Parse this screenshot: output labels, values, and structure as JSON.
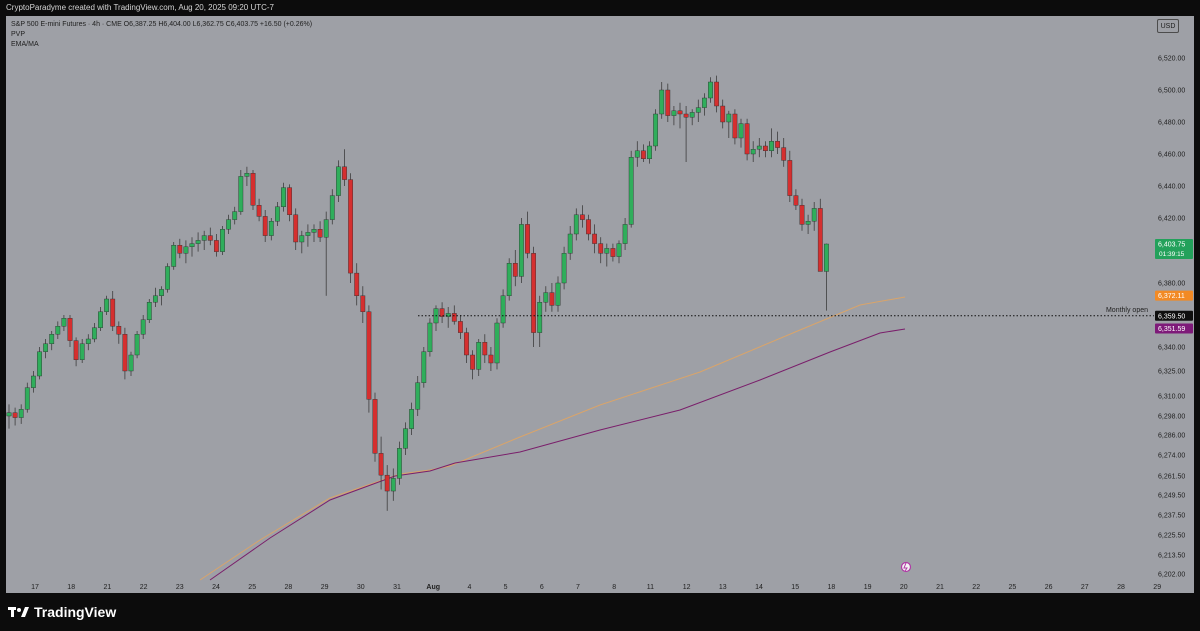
{
  "header": {
    "credit": "CryptoParadyme created with TradingView.com, Aug 20, 2025 09:20 UTC-7"
  },
  "legend": {
    "symbol_line": "S&P 500 E-mini Futures · 4h · CME  O6,387.25  H6,404.00  L6,362.75  C6,403.75  +16.50 (+0.26%)",
    "indicator_1": "PVP",
    "indicator_2": "EMA/MA"
  },
  "currency": "USD",
  "brand": {
    "name": "TradingView"
  },
  "chart_data": {
    "type": "candlestick",
    "timeframe": "4h",
    "x_tick_labels": [
      "17",
      "18",
      "21",
      "22",
      "23",
      "24",
      "25",
      "28",
      "29",
      "30",
      "31",
      "Aug",
      "4",
      "5",
      "6",
      "7",
      "8",
      "11",
      "12",
      "13",
      "14",
      "15",
      "18",
      "19",
      "20",
      "21",
      "22",
      "25",
      "26",
      "27",
      "28",
      "29"
    ],
    "y_tick_labels": [
      "6,520.00",
      "6,500.00",
      "6,480.00",
      "6,460.00",
      "6,440.00",
      "6,420.00",
      "6,400.00",
      "6,380.00",
      "6,360.00",
      "6,340.00",
      "6,325.00",
      "6,310.00",
      "6,298.00",
      "6,286.00",
      "6,274.00",
      "6,261.50",
      "6,249.50",
      "6,237.50",
      "6,225.50",
      "6,213.50",
      "6,202.00"
    ],
    "ylim": [
      6202.0,
      6530.0
    ],
    "price_scale": [
      [
        6202.0,
        574
      ],
      [
        6213.5,
        555
      ],
      [
        6225.5,
        535
      ],
      [
        6237.5,
        515
      ],
      [
        6249.5,
        495
      ],
      [
        6261.5,
        476
      ],
      [
        6274.0,
        455
      ],
      [
        6286.0,
        435
      ],
      [
        6298.0,
        416
      ],
      [
        6310.0,
        396
      ],
      [
        6325.0,
        371
      ],
      [
        6340.0,
        347
      ],
      [
        6360.0,
        315
      ],
      [
        6380.0,
        283
      ],
      [
        6400.0,
        250
      ],
      [
        6420.0,
        218
      ],
      [
        6440.0,
        186
      ],
      [
        6460.0,
        154
      ],
      [
        6480.0,
        122
      ],
      [
        6500.0,
        90
      ],
      [
        6520.0,
        58
      ]
    ],
    "candle_start_x": 9,
    "candle_step": 6.1,
    "candle_pattern": "Sequential 4h bars from Jul 17 to Aug 20, 2025; OHLC estimated from the screenshot",
    "ohlc": [
      [
        6298,
        6305,
        6290,
        6300
      ],
      [
        6300,
        6303,
        6292,
        6297
      ],
      [
        6297,
        6305,
        6293,
        6302
      ],
      [
        6302,
        6318,
        6300,
        6315
      ],
      [
        6315,
        6325,
        6312,
        6322
      ],
      [
        6322,
        6340,
        6320,
        6337
      ],
      [
        6337,
        6345,
        6333,
        6342
      ],
      [
        6342,
        6350,
        6338,
        6348
      ],
      [
        6348,
        6356,
        6345,
        6353
      ],
      [
        6353,
        6360,
        6350,
        6358
      ],
      [
        6358,
        6360,
        6340,
        6344
      ],
      [
        6344,
        6346,
        6328,
        6332
      ],
      [
        6332,
        6345,
        6330,
        6342
      ],
      [
        6342,
        6348,
        6338,
        6345
      ],
      [
        6345,
        6355,
        6343,
        6352
      ],
      [
        6352,
        6365,
        6350,
        6362
      ],
      [
        6362,
        6372,
        6360,
        6370
      ],
      [
        6370,
        6375,
        6350,
        6353
      ],
      [
        6353,
        6356,
        6342,
        6348
      ],
      [
        6348,
        6352,
        6320,
        6325
      ],
      [
        6325,
        6337,
        6322,
        6335
      ],
      [
        6335,
        6350,
        6333,
        6348
      ],
      [
        6348,
        6360,
        6345,
        6357
      ],
      [
        6357,
        6370,
        6355,
        6368
      ],
      [
        6368,
        6377,
        6365,
        6372
      ],
      [
        6372,
        6378,
        6366,
        6376
      ],
      [
        6376,
        6392,
        6374,
        6390
      ],
      [
        6390,
        6405,
        6388,
        6403
      ],
      [
        6403,
        6407,
        6395,
        6398
      ],
      [
        6398,
        6406,
        6392,
        6402
      ],
      [
        6402,
        6408,
        6396,
        6404
      ],
      [
        6404,
        6411,
        6399,
        6406
      ],
      [
        6406,
        6412,
        6400,
        6409
      ],
      [
        6409,
        6414,
        6403,
        6406
      ],
      [
        6406,
        6410,
        6396,
        6399
      ],
      [
        6399,
        6415,
        6397,
        6413
      ],
      [
        6413,
        6422,
        6410,
        6419
      ],
      [
        6419,
        6427,
        6416,
        6424
      ],
      [
        6424,
        6450,
        6422,
        6446
      ],
      [
        6446,
        6452,
        6440,
        6448
      ],
      [
        6448,
        6450,
        6425,
        6428
      ],
      [
        6428,
        6432,
        6418,
        6421
      ],
      [
        6421,
        6425,
        6405,
        6409
      ],
      [
        6409,
        6420,
        6406,
        6418
      ],
      [
        6418,
        6430,
        6415,
        6427
      ],
      [
        6427,
        6442,
        6424,
        6439
      ],
      [
        6439,
        6441,
        6418,
        6422
      ],
      [
        6422,
        6426,
        6400,
        6405
      ],
      [
        6405,
        6412,
        6398,
        6409
      ],
      [
        6409,
        6416,
        6402,
        6411
      ],
      [
        6411,
        6416,
        6405,
        6413
      ],
      [
        6413,
        6418,
        6405,
        6408
      ],
      [
        6408,
        6424,
        6372,
        6419
      ],
      [
        6419,
        6438,
        6416,
        6434
      ],
      [
        6434,
        6456,
        6430,
        6452
      ],
      [
        6452,
        6463,
        6440,
        6444
      ],
      [
        6444,
        6448,
        6380,
        6386
      ],
      [
        6386,
        6392,
        6366,
        6372
      ],
      [
        6372,
        6378,
        6355,
        6362
      ],
      [
        6362,
        6366,
        6300,
        6308
      ],
      [
        6308,
        6312,
        6270,
        6275
      ],
      [
        6275,
        6285,
        6253,
        6262
      ],
      [
        6262,
        6268,
        6240,
        6252
      ],
      [
        6252,
        6266,
        6246,
        6260
      ],
      [
        6260,
        6282,
        6256,
        6278
      ],
      [
        6278,
        6294,
        6274,
        6290
      ],
      [
        6290,
        6306,
        6286,
        6302
      ],
      [
        6302,
        6322,
        6298,
        6318
      ],
      [
        6318,
        6340,
        6315,
        6337
      ],
      [
        6337,
        6358,
        6334,
        6355
      ],
      [
        6355,
        6366,
        6350,
        6364
      ],
      [
        6364,
        6368,
        6355,
        6359
      ],
      [
        6359,
        6365,
        6352,
        6361
      ],
      [
        6361,
        6366,
        6354,
        6356
      ],
      [
        6356,
        6360,
        6345,
        6349
      ],
      [
        6349,
        6352,
        6330,
        6335
      ],
      [
        6335,
        6338,
        6320,
        6326
      ],
      [
        6326,
        6345,
        6322,
        6343
      ],
      [
        6343,
        6348,
        6330,
        6335
      ],
      [
        6335,
        6340,
        6325,
        6330
      ],
      [
        6330,
        6358,
        6326,
        6355
      ],
      [
        6355,
        6376,
        6352,
        6372
      ],
      [
        6372,
        6395,
        6369,
        6392
      ],
      [
        6392,
        6400,
        6378,
        6384
      ],
      [
        6384,
        6420,
        6380,
        6416
      ],
      [
        6416,
        6424,
        6395,
        6398
      ],
      [
        6398,
        6402,
        6340,
        6349
      ],
      [
        6349,
        6372,
        6340,
        6368
      ],
      [
        6368,
        6378,
        6362,
        6374
      ],
      [
        6374,
        6380,
        6362,
        6366
      ],
      [
        6366,
        6384,
        6362,
        6380
      ],
      [
        6380,
        6402,
        6376,
        6398
      ],
      [
        6398,
        6415,
        6394,
        6410
      ],
      [
        6410,
        6426,
        6406,
        6422
      ],
      [
        6422,
        6428,
        6414,
        6419
      ],
      [
        6419,
        6422,
        6406,
        6410
      ],
      [
        6410,
        6416,
        6398,
        6404
      ],
      [
        6404,
        6408,
        6392,
        6398
      ],
      [
        6398,
        6404,
        6390,
        6401
      ],
      [
        6401,
        6404,
        6393,
        6396
      ],
      [
        6396,
        6406,
        6392,
        6404
      ],
      [
        6404,
        6420,
        6400,
        6416
      ],
      [
        6416,
        6462,
        6414,
        6458
      ],
      [
        6458,
        6468,
        6452,
        6462
      ],
      [
        6462,
        6466,
        6455,
        6457
      ],
      [
        6457,
        6468,
        6454,
        6465
      ],
      [
        6465,
        6488,
        6462,
        6485
      ],
      [
        6485,
        6505,
        6482,
        6500
      ],
      [
        6500,
        6504,
        6480,
        6484
      ],
      [
        6484,
        6490,
        6478,
        6487
      ],
      [
        6487,
        6492,
        6476,
        6485
      ],
      [
        6485,
        6490,
        6455,
        6483
      ],
      [
        6483,
        6488,
        6478,
        6486
      ],
      [
        6486,
        6494,
        6480,
        6489
      ],
      [
        6489,
        6498,
        6484,
        6495
      ],
      [
        6495,
        6508,
        6492,
        6505
      ],
      [
        6505,
        6509,
        6486,
        6490
      ],
      [
        6490,
        6494,
        6476,
        6480
      ],
      [
        6480,
        6487,
        6470,
        6485
      ],
      [
        6485,
        6488,
        6466,
        6470
      ],
      [
        6470,
        6482,
        6464,
        6479
      ],
      [
        6479,
        6482,
        6456,
        6460
      ],
      [
        6460,
        6468,
        6455,
        6463
      ],
      [
        6463,
        6470,
        6458,
        6465
      ],
      [
        6465,
        6468,
        6458,
        6462
      ],
      [
        6462,
        6476,
        6458,
        6468
      ],
      [
        6468,
        6474,
        6460,
        6464
      ],
      [
        6464,
        6470,
        6452,
        6456
      ],
      [
        6456,
        6462,
        6430,
        6434
      ],
      [
        6434,
        6438,
        6425,
        6428
      ],
      [
        6428,
        6432,
        6412,
        6416
      ],
      [
        6416,
        6422,
        6410,
        6418
      ],
      [
        6418,
        6430,
        6412,
        6426
      ],
      [
        6426,
        6432,
        6400,
        6387
      ],
      [
        6387,
        6404,
        6362.75,
        6403.75
      ]
    ],
    "overlays": [
      {
        "name": "EMA",
        "color": "#d9a46a",
        "points": [
          [
            200,
            580
          ],
          [
            260,
            540
          ],
          [
            330,
            498
          ],
          [
            400,
            474
          ],
          [
            430,
            470
          ],
          [
            450,
            466
          ],
          [
            520,
            437
          ],
          [
            600,
            405
          ],
          [
            700,
            372
          ],
          [
            800,
            330
          ],
          [
            860,
            305
          ],
          [
            905,
            297
          ]
        ]
      },
      {
        "name": "MA",
        "color": "#7a1f6b",
        "points": [
          [
            210,
            580
          ],
          [
            270,
            538
          ],
          [
            330,
            500
          ],
          [
            395,
            476
          ],
          [
            430,
            471
          ],
          [
            455,
            463
          ],
          [
            520,
            452
          ],
          [
            600,
            430
          ],
          [
            680,
            410
          ],
          [
            760,
            380
          ],
          [
            830,
            352
          ],
          [
            880,
            333
          ],
          [
            905,
            329
          ]
        ]
      }
    ],
    "horizontal_line": {
      "label": "Monthly open",
      "value": 6359.5,
      "style": "dotted"
    },
    "price_labels": [
      {
        "value": 6403.75,
        "text": "6,403.75",
        "subtext": "01:39:15",
        "color": "#23a15b"
      },
      {
        "value": 6372.11,
        "text": "6,372.11",
        "color": "#f28a24"
      },
      {
        "value": 6359.5,
        "text": "6,359.50",
        "color": "#0e0e0e"
      },
      {
        "value": 6351.59,
        "text": "6,351.59",
        "color": "#7e1a79"
      }
    ],
    "colors": {
      "up": "#2fae5b",
      "down": "#d52f2f",
      "wick": "#3d3d3d",
      "background": "#9ea0a6"
    }
  }
}
